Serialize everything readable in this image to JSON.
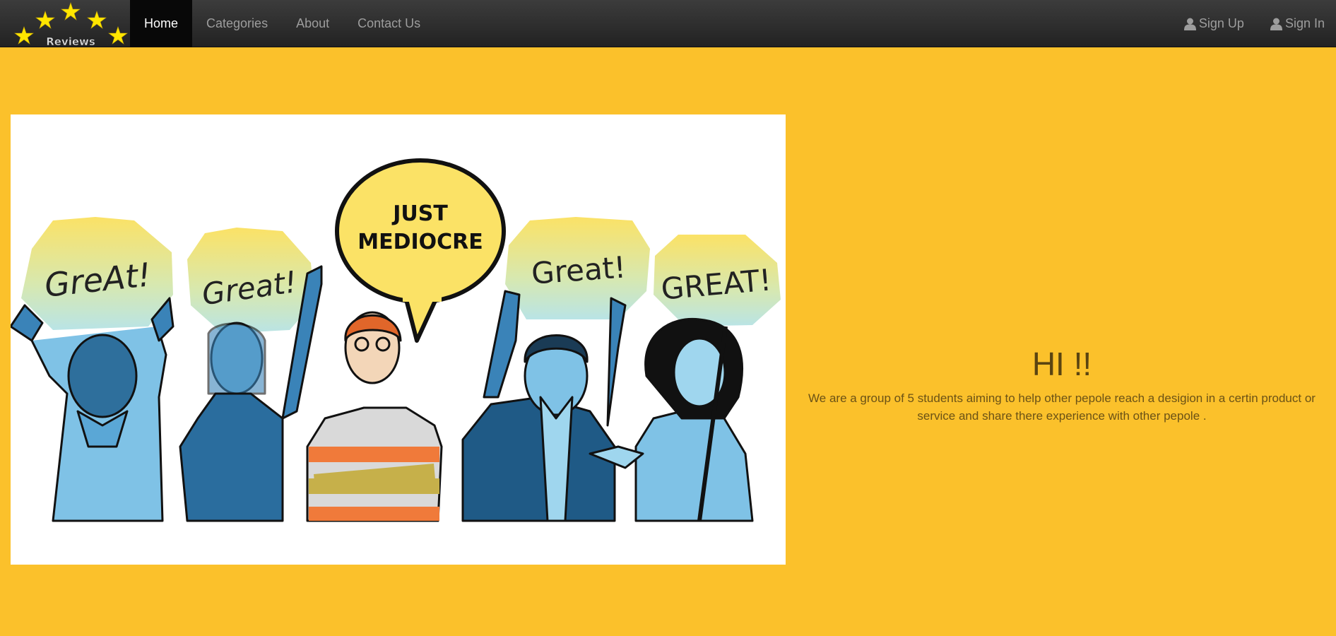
{
  "brand": {
    "logo_text": "Reviews"
  },
  "nav": {
    "items": [
      {
        "label": "Home",
        "active": true
      },
      {
        "label": "Categories",
        "active": false
      },
      {
        "label": "About",
        "active": false
      },
      {
        "label": "Contact Us",
        "active": false
      }
    ],
    "right": [
      {
        "label": "Sign Up",
        "icon": "user-icon"
      },
      {
        "label": "Sign In",
        "icon": "user-icon"
      }
    ]
  },
  "illustration": {
    "bubbles": [
      "GreAt!",
      "Great!",
      "JUST",
      "MEDIOCRE",
      "Great!",
      "GREAT!"
    ]
  },
  "hero": {
    "heading": "HI !!",
    "text": "We are a group of 5 students aiming to help other pepole reach a desigion in a certin product or service and share there experience with other pepole ."
  },
  "colors": {
    "background": "#fbc12b",
    "navbar": "#2b2b2b",
    "bubble_yellow": "#fbe266",
    "bubble_teal": "#bfe6e6",
    "figure_blue": "#3a83b8"
  }
}
